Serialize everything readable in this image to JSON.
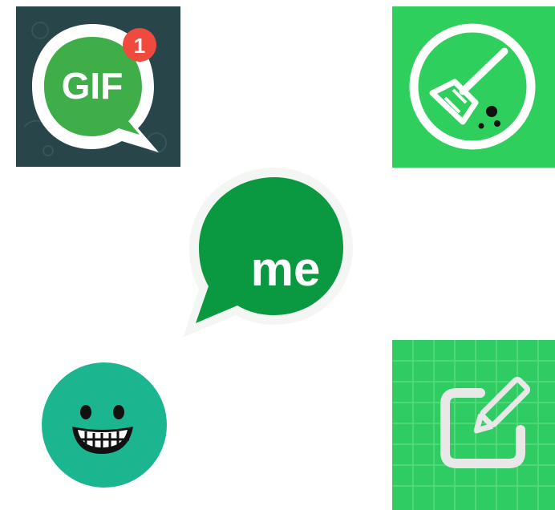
{
  "icons": {
    "gif": {
      "label": "GIF",
      "badge_count": "1",
      "icon": "gif-chat-icon",
      "colors": {
        "background": "#28464a",
        "bubble_ring": "#ffffff",
        "bubble": "#3fae48",
        "badge": "#f04a3f"
      }
    },
    "cleaner": {
      "icon": "broom-cleaner-icon",
      "colors": {
        "background": "#2fcf5d",
        "stroke": "#ffffff",
        "dust": "#111111"
      }
    },
    "me": {
      "label": "me",
      "icon": "me-chat-bubble-icon",
      "colors": {
        "bubble": "#0a9941",
        "text": "#ffffff"
      }
    },
    "smile": {
      "icon": "grinning-face-icon",
      "colors": {
        "face": "#1bb58f",
        "features": "#111111",
        "teeth": "#ffffff"
      }
    },
    "notes": {
      "icon": "edit-note-icon",
      "colors": {
        "background": "#2fcc63",
        "grid": "#5ad97f",
        "stroke": "#f2f2f2"
      }
    }
  }
}
